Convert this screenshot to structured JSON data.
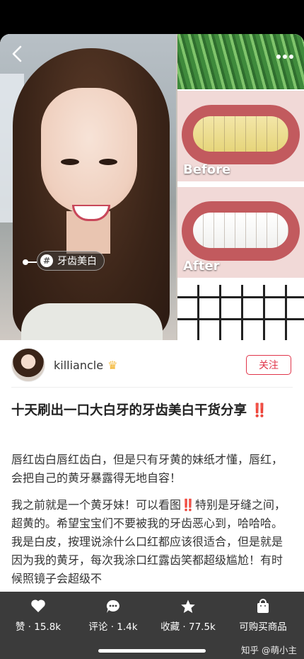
{
  "hero": {
    "before_label": "Before",
    "after_label": "After",
    "tag_label": "牙齿美白"
  },
  "author": {
    "name": "killiancle",
    "follow_label": "关注"
  },
  "post": {
    "title": "十天刷出一口大白牙的牙齿美白干货分享",
    "title_mark": "‼️",
    "paragraph1": "唇红齿白唇红齿白，但是只有牙黄的妹纸才懂，唇红，会把自己的黄牙暴露得无地自容！",
    "paragraph2_a": "我之前就是一个黄牙妹！可以看图",
    "paragraph2_mark": "‼️",
    "paragraph2_b": "特别是牙缝之间，超黄的。希望宝宝们不要被我的牙齿恶心到，哈哈哈。我是白皮，按理说涂什么口红都应该很适合，但是就是因为我的黄牙，每次我涂口红露齿笑都超级尴尬！有时候照镜子会超级不"
  },
  "bottom_bar": {
    "like": "赞 · 15.8k",
    "comment": "评论 · 1.4k",
    "favorite": "收藏 · 77.5k",
    "buy": "可购买商品"
  },
  "watermark": "知乎 @萌小主",
  "colors": {
    "accent_red": "#e0354a",
    "bottom_bar_bg": "#3b3b3b"
  }
}
